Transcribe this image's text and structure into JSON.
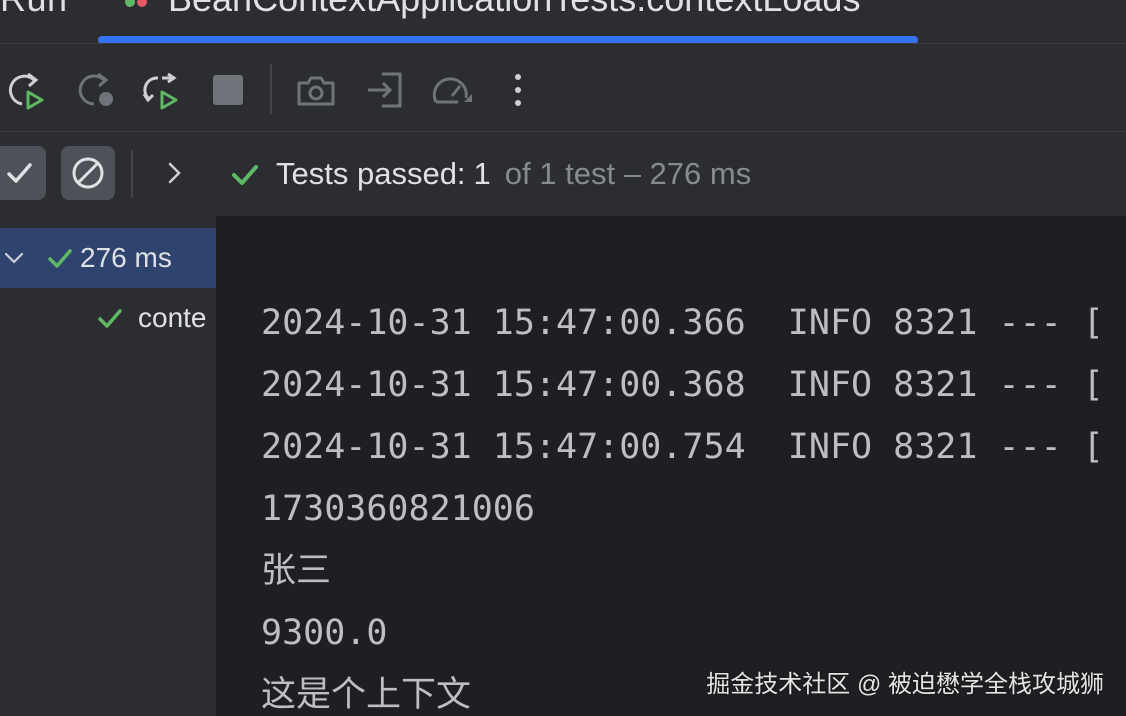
{
  "tab": {
    "run_label": "Run",
    "title": "BeanContextApplicationTests.contextLoads",
    "close_glyph": "×"
  },
  "toolbar": {
    "icons": [
      "rerun-icon",
      "rerun-failed-icon",
      "toggle-auto-test-icon",
      "stop-icon",
      "screenshot-icon",
      "import-tests-icon",
      "profiler-icon",
      "more-options-icon"
    ]
  },
  "status": {
    "passed_label": "Tests passed:",
    "passed_count": "1",
    "rest": "of 1 test – 276 ms"
  },
  "tree": {
    "root_label": "276 ms",
    "child_label": "conte"
  },
  "console": {
    "lines": [
      "2024-10-31 15:47:00.366  INFO 8321 --- [",
      "2024-10-31 15:47:00.368  INFO 8321 --- [",
      "2024-10-31 15:47:00.754  INFO 8321 --- [",
      "1730360821006",
      "张三",
      "9300.0",
      "这是个上下文"
    ]
  },
  "watermark": "掘金技术社区 @ 被迫懋学全栈攻城狮",
  "colors": {
    "accent": "#3574f0",
    "success": "#5fb865",
    "selection": "#2e436e"
  }
}
